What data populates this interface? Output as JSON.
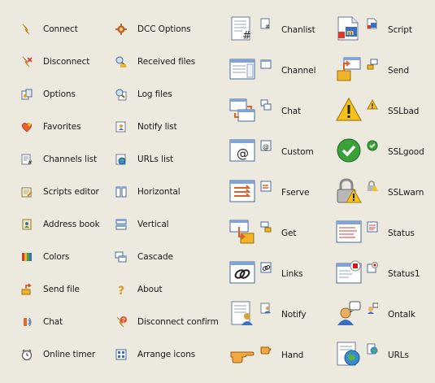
{
  "col1": [
    {
      "label": "Connect",
      "icon": "connect-icon"
    },
    {
      "label": "Disconnect",
      "icon": "disconnect-icon"
    },
    {
      "label": "Options",
      "icon": "options-icon"
    },
    {
      "label": "Favorites",
      "icon": "favorites-icon"
    },
    {
      "label": "Channels list",
      "icon": "channels-list-icon"
    },
    {
      "label": "Scripts editor",
      "icon": "scripts-editor-icon"
    },
    {
      "label": "Address book",
      "icon": "address-book-icon"
    },
    {
      "label": "Colors",
      "icon": "colors-icon"
    },
    {
      "label": "Send file",
      "icon": "send-file-icon"
    },
    {
      "label": "Chat",
      "icon": "chat-icon"
    },
    {
      "label": "Online timer",
      "icon": "online-timer-icon"
    }
  ],
  "col2": [
    {
      "label": "DCC Options",
      "icon": "dcc-options-icon"
    },
    {
      "label": "Received files",
      "icon": "received-files-icon"
    },
    {
      "label": "Log files",
      "icon": "log-files-icon"
    },
    {
      "label": "Notify list",
      "icon": "notify-list-icon"
    },
    {
      "label": "URLs list",
      "icon": "urls-list-icon"
    },
    {
      "label": "Horizontal",
      "icon": "horizontal-icon"
    },
    {
      "label": "Vertical",
      "icon": "vertical-icon"
    },
    {
      "label": "Cascade",
      "icon": "cascade-icon"
    },
    {
      "label": "About",
      "icon": "about-icon"
    },
    {
      "label": "Disconnect confirm",
      "icon": "disconnect-confirm-icon"
    },
    {
      "label": "Arrange icons",
      "icon": "arrange-icons-icon"
    }
  ],
  "col3": [
    {
      "label": "Chanlist",
      "icon": "chanlist-icon"
    },
    {
      "label": "Channel",
      "icon": "channel-icon"
    },
    {
      "label": "Chat",
      "icon": "chat-window-icon"
    },
    {
      "label": "Custom",
      "icon": "custom-icon"
    },
    {
      "label": "Fserve",
      "icon": "fserve-icon"
    },
    {
      "label": "Get",
      "icon": "get-icon"
    },
    {
      "label": "Links",
      "icon": "links-icon"
    },
    {
      "label": "Notify",
      "icon": "notify-icon"
    },
    {
      "label": "Hand",
      "icon": "hand-icon"
    }
  ],
  "col4": [
    {
      "label": "Script",
      "icon": "script-icon"
    },
    {
      "label": "Send",
      "icon": "send-icon"
    },
    {
      "label": "SSLbad",
      "icon": "ssl-bad-icon"
    },
    {
      "label": "SSLgood",
      "icon": "ssl-good-icon"
    },
    {
      "label": "SSLwarn",
      "icon": "ssl-warn-icon"
    },
    {
      "label": "Status",
      "icon": "status-icon"
    },
    {
      "label": "Status1",
      "icon": "status1-icon"
    },
    {
      "label": "Ontalk",
      "icon": "ontalk-icon"
    },
    {
      "label": "URLs",
      "icon": "urls-icon"
    }
  ],
  "colors": {
    "background": "#ece9de",
    "text": "#1a1a1a"
  }
}
